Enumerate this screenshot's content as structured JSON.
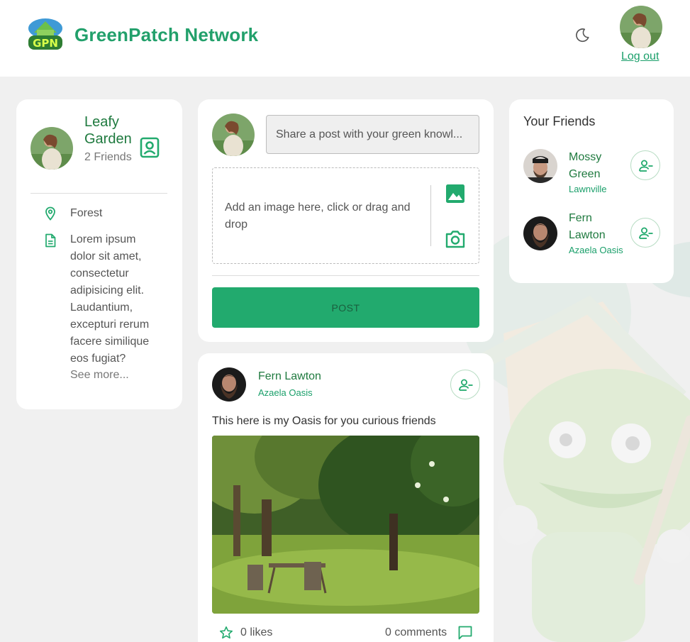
{
  "header": {
    "brand": "GreenPatch Network",
    "logout_label": "Log out",
    "logo_text": "GPN"
  },
  "profile": {
    "name": "Leafy Garden",
    "friends_count": "2 Friends",
    "location": "Forest",
    "bio": "Lorem ipsum dolor sit amet, consectetur adipisicing elit. Laudantium, excepturi rerum facere similique eos fugiat?",
    "see_more": "See more..."
  },
  "composer": {
    "placeholder": "Share a post with your green knowl...",
    "dropzone_text": "Add an image here, click or drag and drop",
    "post_label": "POST"
  },
  "feed": {
    "posts": [
      {
        "author": "Fern Lawton",
        "location": "Azaela Oasis",
        "text": "This here is my Oasis for you curious friends",
        "likes": "0 likes",
        "comments": "0 comments"
      }
    ]
  },
  "friends": {
    "title": "Your Friends",
    "items": [
      {
        "name": "Mossy Green",
        "location": "Lawnville"
      },
      {
        "name": "Fern Lawton",
        "location": "Azaela Oasis"
      }
    ]
  },
  "colors": {
    "accent": "#22aa6e",
    "name_green": "#1f7a3f",
    "background": "#f0f0f0"
  },
  "icons": {
    "theme_toggle": "moon-icon",
    "profile_card": "contact-card-icon",
    "location": "map-pin-icon",
    "bio": "document-icon",
    "add_image": "image-icon",
    "camera": "camera-icon",
    "remove_friend": "person-remove-icon",
    "like": "star-icon",
    "comments": "chat-bubble-icon"
  }
}
